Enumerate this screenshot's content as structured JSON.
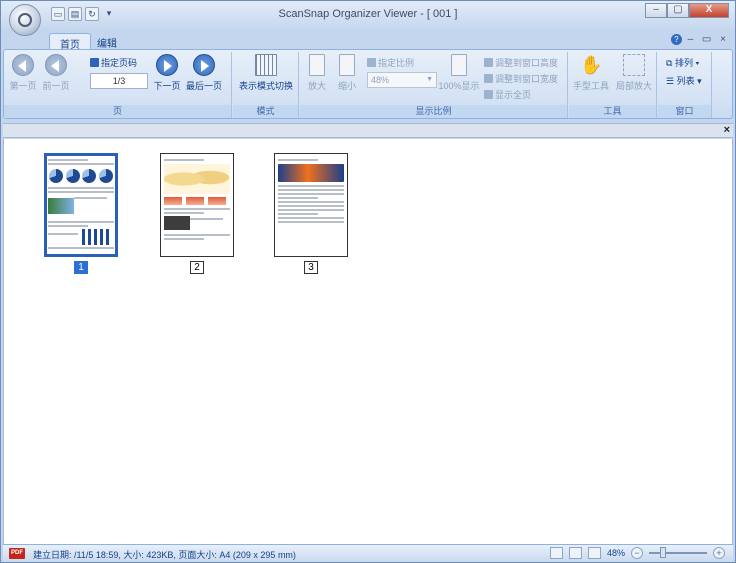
{
  "window": {
    "title": "ScanSnap Organizer Viewer - [ 001 ]",
    "controls": [
      "–",
      "▢",
      "X"
    ]
  },
  "quick_access": [
    "save-icon",
    "print-icon",
    "rotate-icon",
    "▾"
  ],
  "tabs": [
    {
      "label": "首页",
      "active": true
    },
    {
      "label": "编辑",
      "active": false
    }
  ],
  "tab_right": {
    "help": "?",
    "extras": "– ▭ ×"
  },
  "ribbon": {
    "page_group": {
      "label": "页",
      "first": "第一页",
      "prev": "前一页",
      "spec_page": "指定页码",
      "page_value": "1/3",
      "next": "下一页",
      "last": "最后一页"
    },
    "mode_group": {
      "label": "模式",
      "switch": "表示模式切换"
    },
    "zoom_group": {
      "label": "显示比例",
      "zoom_in": "放大",
      "zoom_out": "缩小",
      "spec_ratio": "指定比例",
      "ratio_value": "48%",
      "hundred": "100%显示",
      "fit_height": "调整到窗口高度",
      "fit_width": "调整到窗口宽度",
      "show_all": "显示全页"
    },
    "tools_group": {
      "label": "工具",
      "hand": "手型工具",
      "local_zoom": "局部放大"
    },
    "window_group": {
      "label": "窗口",
      "arrange": "排列 ▾",
      "list": "列表 ▾"
    }
  },
  "content": {
    "close": "×",
    "thumbnails": [
      {
        "number": "1",
        "selected": true
      },
      {
        "number": "2",
        "selected": false
      },
      {
        "number": "3",
        "selected": false
      }
    ]
  },
  "status": {
    "badge": "PDF",
    "text": "建立日期:        /11/5 18:59, 大小: 423KB, 页面大小: A4 (209 x 295 mm)",
    "zoom": "48%",
    "zoom_minus": "−",
    "zoom_plus": "+",
    "slider_level": 0.22
  }
}
